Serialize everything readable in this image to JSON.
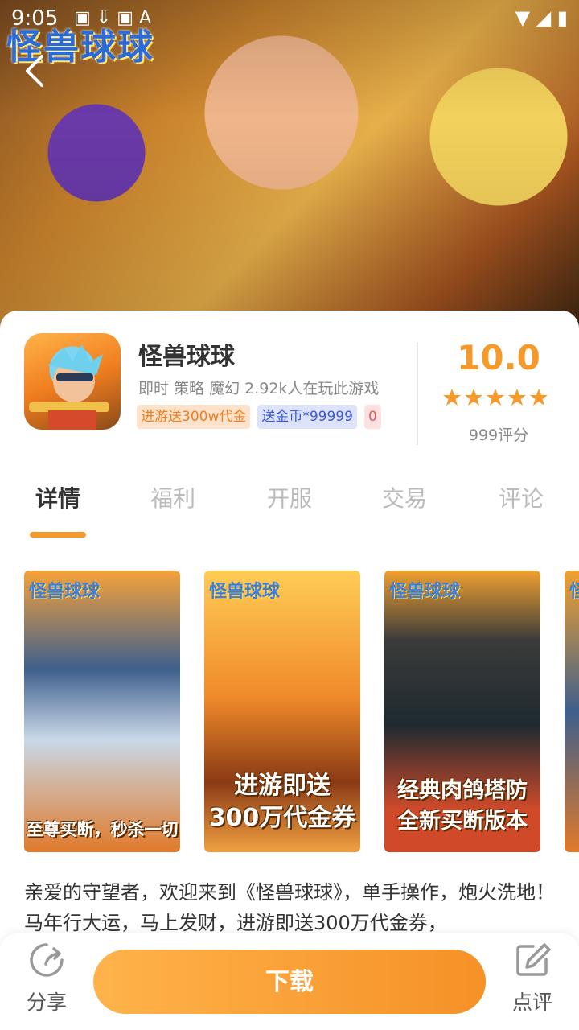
{
  "status_bar": {
    "time": "9:05",
    "left_icons": "▣ ⇓ ▣ A",
    "right_icons": "▼ ◢ ▮"
  },
  "hero": {
    "logo_text": "怪兽球球"
  },
  "app": {
    "name": "怪兽球球",
    "meta": "即时 策略 魔幻  2.92k人在玩此游戏",
    "tags": [
      "进游送300w代金",
      "送金币*99999",
      "0"
    ],
    "score": "10.0",
    "stars": 5,
    "rating_count": "999评分"
  },
  "tabs": [
    {
      "label": "详情",
      "active": true
    },
    {
      "label": "福利",
      "active": false
    },
    {
      "label": "开服",
      "active": false
    },
    {
      "label": "交易",
      "active": false
    },
    {
      "label": "评论",
      "active": false
    }
  ],
  "screenshots": [
    {
      "title": "怪兽球球",
      "caption": "至尊买断，秒杀一切"
    },
    {
      "title": "怪兽球球",
      "caption_line1": "进游即送",
      "caption_line2": "300万代金券"
    },
    {
      "title": "怪兽球球",
      "caption_line1": "经典肉鸽塔防",
      "caption_line2": "全新买断版本"
    },
    {
      "title": "怪"
    }
  ],
  "description": "亲爱的守望者，欢迎来到《怪兽球球》，单手操作，炮火洗地！马年行大运，马上发财，进游即送300万代金券，",
  "bottom": {
    "share_label": "分享",
    "download_label": "下载",
    "review_label": "点评"
  },
  "colors": {
    "accent": "#f59a2a",
    "tag_orange": "#f07d1e",
    "tag_blue": "#3c5ad8",
    "tag_red": "#e85a5a"
  }
}
